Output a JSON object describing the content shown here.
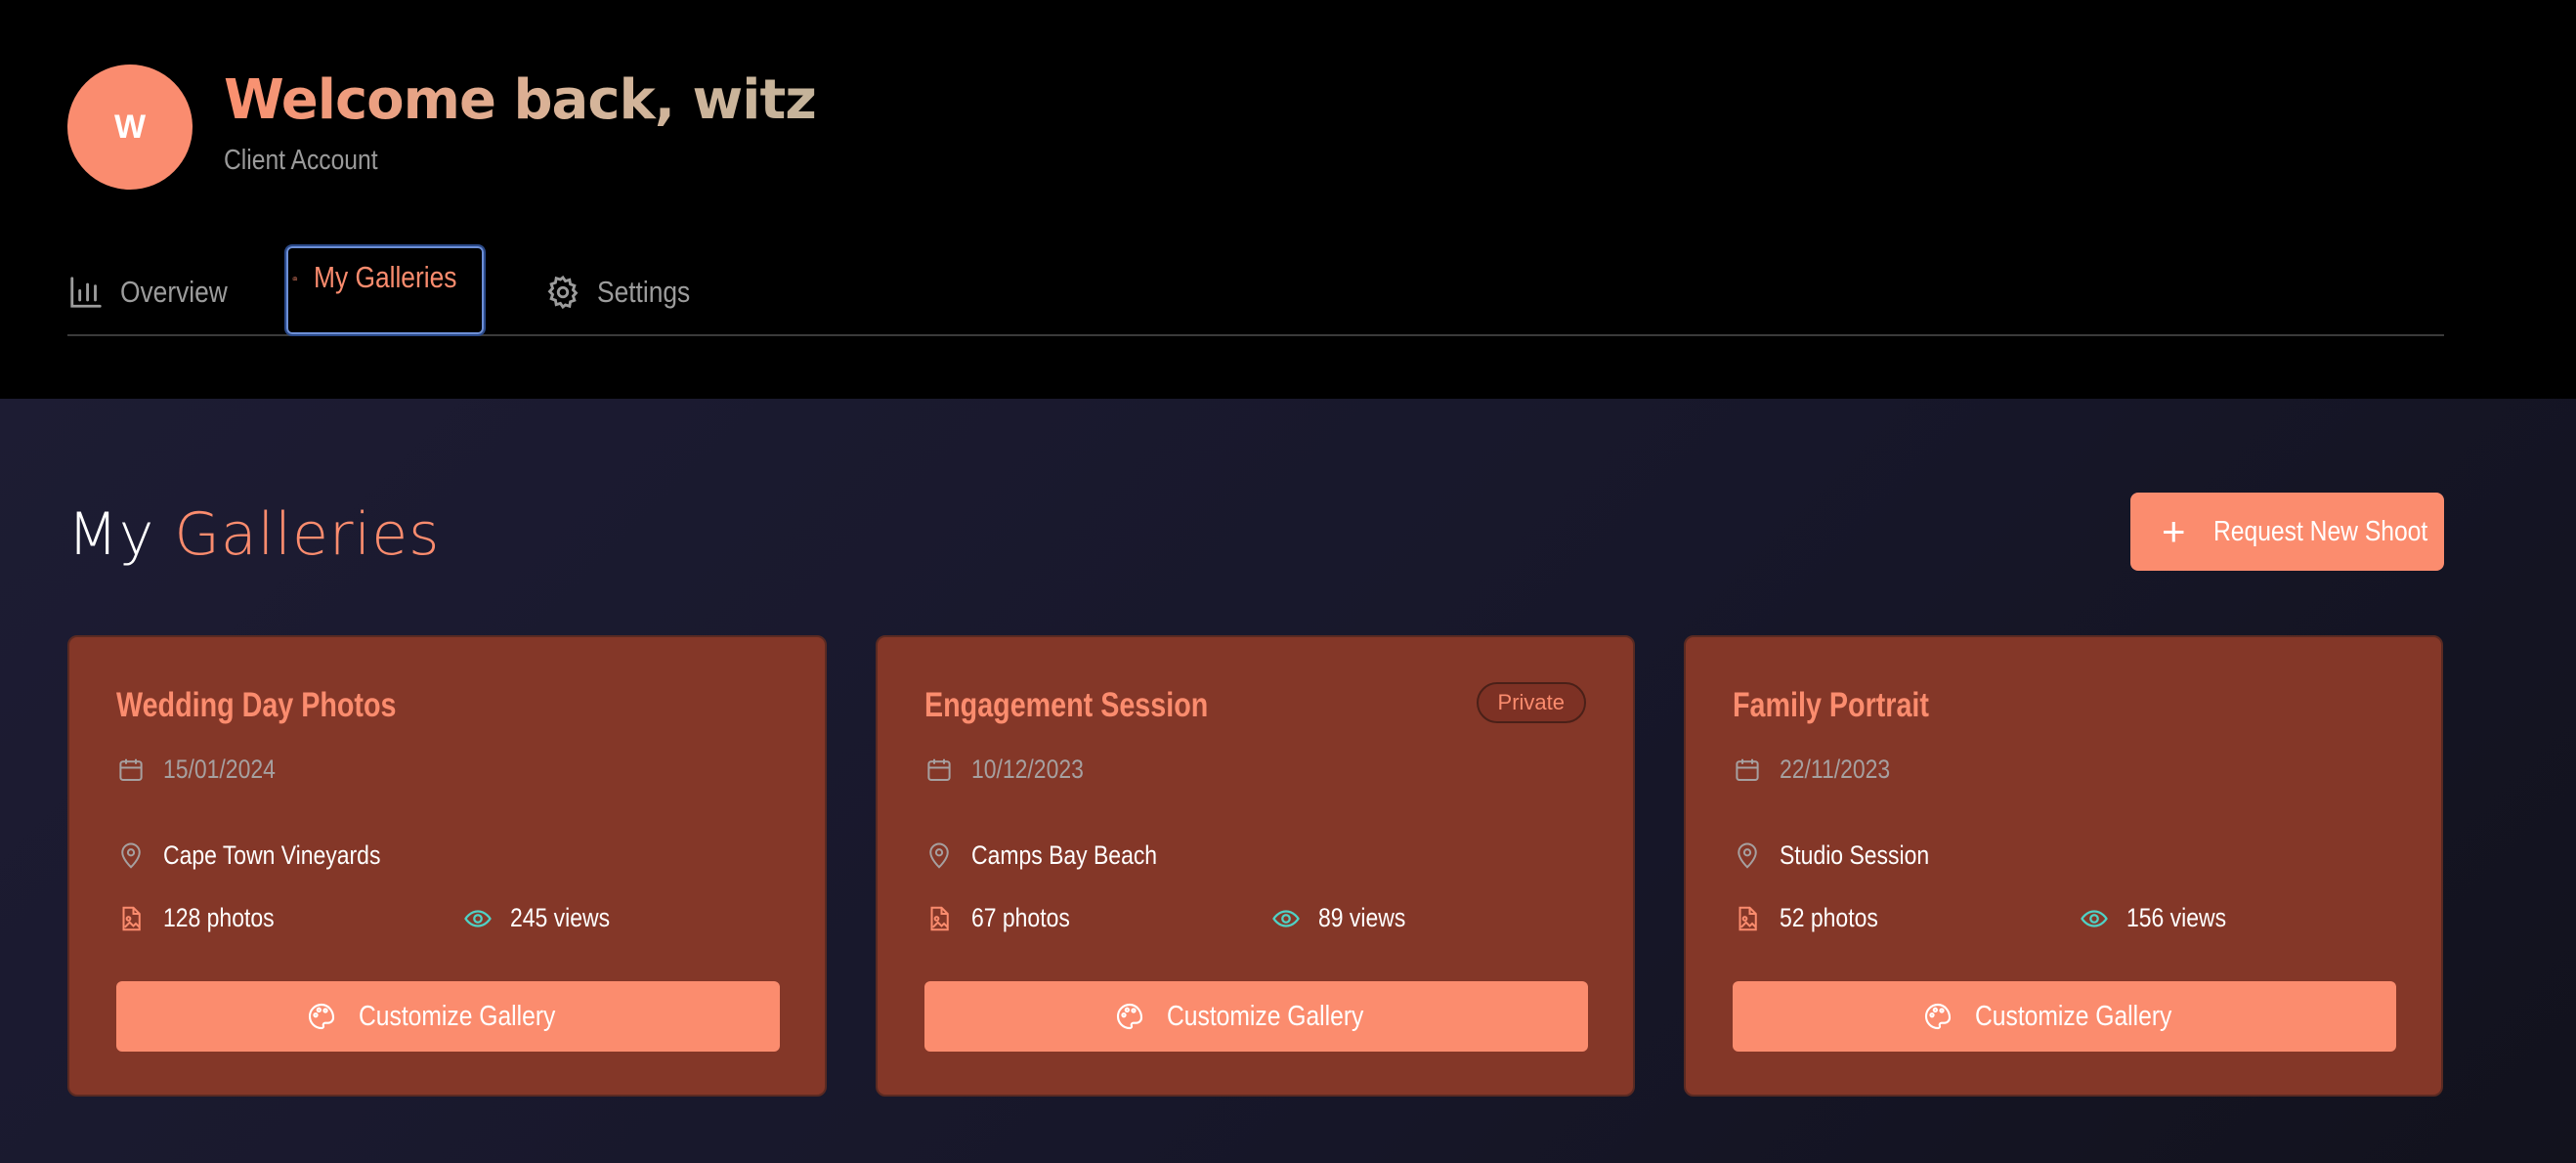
{
  "user": {
    "avatar_letter": "W",
    "welcome": "Welcome back, witz",
    "account_type": "Client Account"
  },
  "tabs": [
    {
      "label": "Overview",
      "icon": "bar-chart-icon"
    },
    {
      "label": "My Galleries",
      "icon": "camera-icon",
      "active": true
    },
    {
      "label": "Settings",
      "icon": "gear-icon"
    }
  ],
  "page": {
    "title_prefix": "My",
    "title_accent": "Galleries",
    "request_button": "Request New Shoot"
  },
  "galleries": [
    {
      "title": "Wedding Day Photos",
      "date": "15/01/2024",
      "location": "Cape Town Vineyards",
      "photos": "128 photos",
      "views": "245 views",
      "button": "Customize Gallery"
    },
    {
      "title": "Engagement Session",
      "badge": "Private",
      "date": "10/12/2023",
      "location": "Camps Bay Beach",
      "photos": "67 photos",
      "views": "89 views",
      "button": "Customize Gallery"
    },
    {
      "title": "Family Portrait",
      "date": "22/11/2023",
      "location": "Studio Session",
      "photos": "52 photos",
      "views": "156 views",
      "button": "Customize Gallery"
    }
  ],
  "colors": {
    "accent": "#fb8c6e",
    "card_bg": "#843728",
    "eye_icon": "#4fd1c5",
    "focus_ring": "#6d8fd6"
  }
}
